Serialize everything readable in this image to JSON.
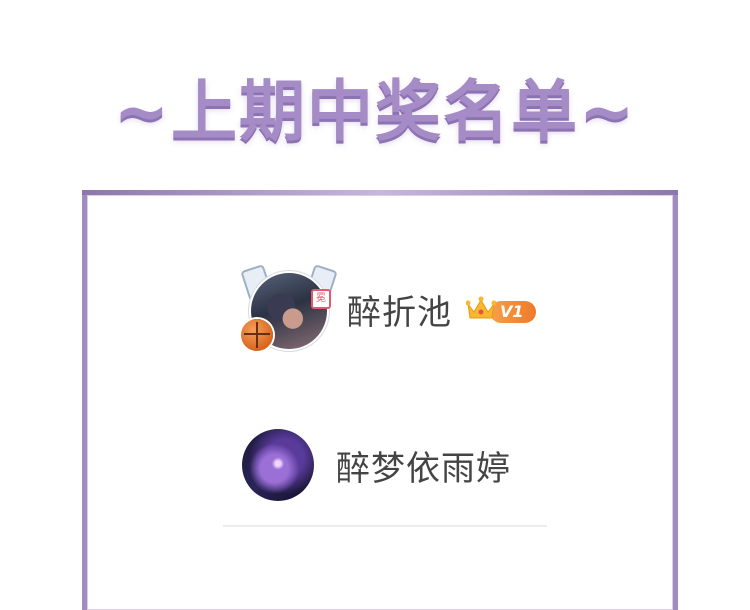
{
  "title": "~上期中奖名单~",
  "winners": [
    {
      "name": "醉折池",
      "badge": "V1",
      "crown_icon": "crown-icon",
      "seal_char": "冕"
    },
    {
      "name": "醉梦依雨婷"
    }
  ],
  "colors": {
    "title": "#a58cc7",
    "frame": "#a08cbe",
    "badge": "#ee7a2a"
  }
}
